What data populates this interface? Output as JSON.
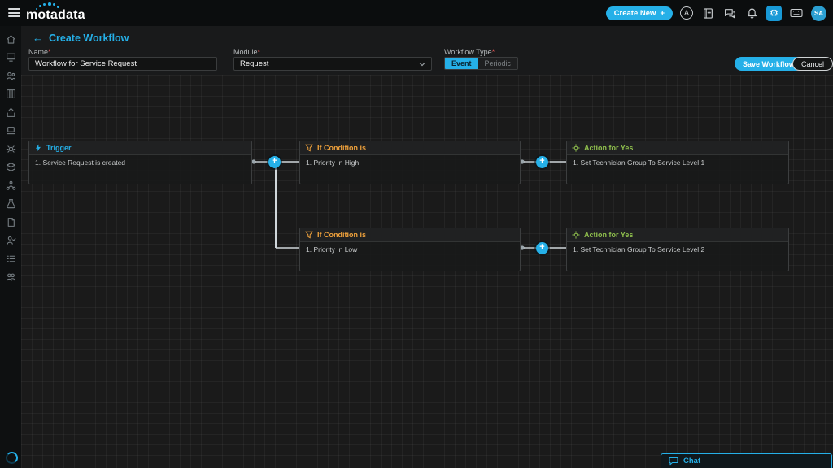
{
  "header": {
    "logo_text": "motadata",
    "create_new_label": "Create New",
    "plus_glyph": "+",
    "ai_badge": "A",
    "gear_glyph": "⚙",
    "avatar_initials": "SA"
  },
  "toolbar": {
    "back_arrow": "←",
    "page_title": "Create Workflow",
    "name_label": "Name",
    "required_mark": "*",
    "name_value": "Workflow for Service Request",
    "module_label": "Module",
    "module_value": "Request",
    "workflow_type_label": "Workflow Type",
    "event_label": "Event",
    "periodic_label": "Periodic",
    "save_label": "Save Workflow",
    "cancel_label": "Cancel"
  },
  "canvas": {
    "plus_glyph": "+",
    "nodes": [
      {
        "title": "Trigger",
        "body": "1. Service Request is created"
      },
      {
        "title": "If Condition is",
        "body": "1. Priority In High"
      },
      {
        "title": "Action for Yes",
        "body": "1. Set Technician Group To Service Level 1"
      },
      {
        "title": "If Condition is",
        "body": "1. Priority In Low"
      },
      {
        "title": "Action for Yes",
        "body": "1. Set Technician Group To Service Level 2"
      }
    ]
  },
  "chat": {
    "label": "Chat"
  },
  "colors": {
    "accent": "#25b0e8",
    "trigger": "#25b0e8",
    "condition": "#f0a23c",
    "action": "#8fbf4d",
    "required": "#e05252"
  }
}
